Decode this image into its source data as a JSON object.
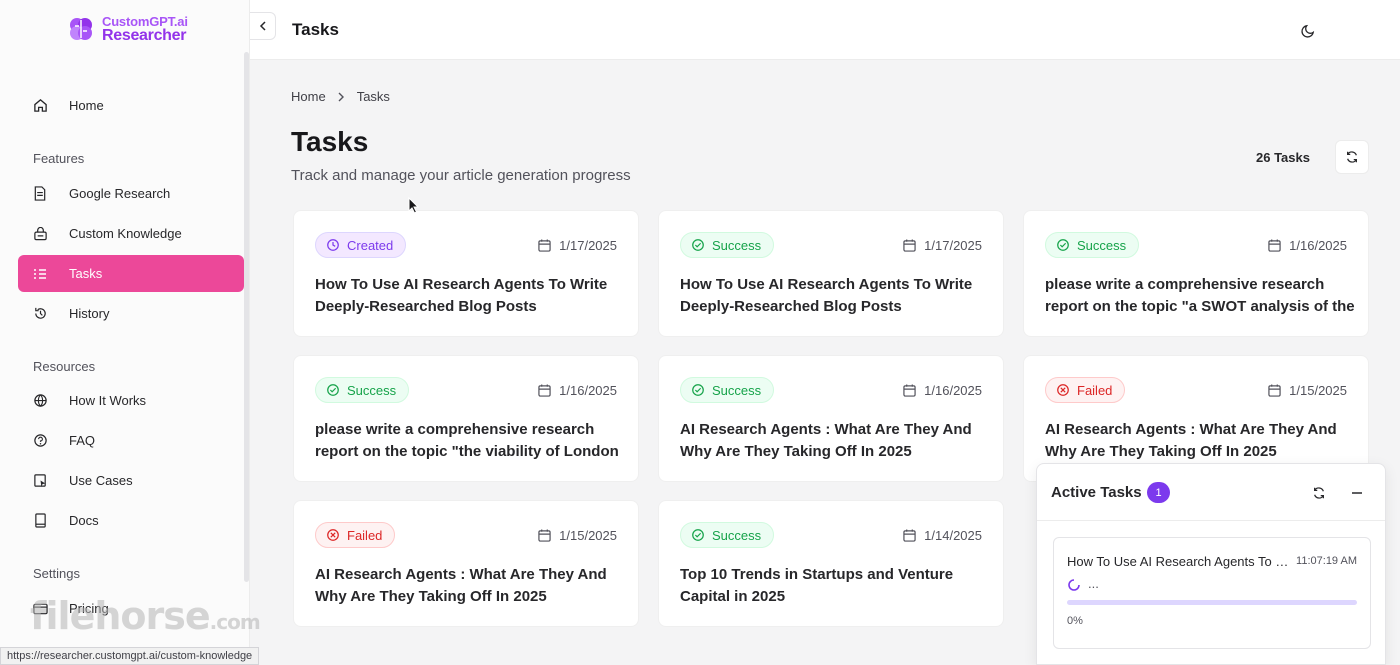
{
  "brand": {
    "line1": "CustomGPT.ai",
    "line2": "Researcher",
    "color": "#9333ea"
  },
  "sidebar": {
    "home": "Home",
    "sections": {
      "features": "Features",
      "resources": "Resources",
      "settings": "Settings"
    },
    "features": [
      {
        "label": "Google Research",
        "icon": "file-icon"
      },
      {
        "label": "Custom Knowledge",
        "icon": "knowledge-icon"
      },
      {
        "label": "Tasks",
        "icon": "list-icon",
        "active": true
      },
      {
        "label": "History",
        "icon": "history-icon"
      }
    ],
    "resources": [
      {
        "label": "How It Works",
        "icon": "globe-icon"
      },
      {
        "label": "FAQ",
        "icon": "help-icon"
      },
      {
        "label": "Use Cases",
        "icon": "use-cases-icon"
      },
      {
        "label": "Docs",
        "icon": "book-icon"
      }
    ],
    "settings": [
      {
        "label": "Pricing",
        "icon": "card-icon"
      }
    ],
    "accent": "#ec4899"
  },
  "topbar": {
    "title": "Tasks"
  },
  "breadcrumb": {
    "home": "Home",
    "current": "Tasks"
  },
  "page": {
    "title": "Tasks",
    "subtitle": "Track and manage your article generation progress",
    "task_count": "26 Tasks"
  },
  "tasks": [
    {
      "status": "Created",
      "date": "1/17/2025",
      "title": "How To Use AI Research Agents To Write Deeply-Researched Blog Posts"
    },
    {
      "status": "Success",
      "date": "1/17/2025",
      "title": "How To Use AI Research Agents To Write Deeply-Researched Blog Posts"
    },
    {
      "status": "Success",
      "date": "1/16/2025",
      "title": "please write a comprehensive research report on the topic \"a SWOT analysis of the"
    },
    {
      "status": "Success",
      "date": "1/16/2025",
      "title": "please write a comprehensive research report on the topic \"the viability of London"
    },
    {
      "status": "Success",
      "date": "1/16/2025",
      "title": "AI Research Agents : What Are They And Why Are They Taking Off In 2025"
    },
    {
      "status": "Failed",
      "date": "1/15/2025",
      "title": "AI Research Agents : What Are They And Why Are They Taking Off In 2025"
    },
    {
      "status": "Failed",
      "date": "1/15/2025",
      "title": "AI Research Agents : What Are They And Why Are They Taking Off In 2025"
    },
    {
      "status": "Success",
      "date": "1/14/2025",
      "title": "Top 10 Trends in Startups and Venture Capital in 2025"
    }
  ],
  "active_tasks": {
    "title": "Active Tasks",
    "count": "1",
    "item": {
      "title": "How To Use AI Research Agents To Write Deeply-Researched Blog Posts",
      "time": "11:07:19 AM",
      "status": "...",
      "progress": 0,
      "progress_label": "0%"
    }
  },
  "statusbar": {
    "url": "https://researcher.customgpt.ai/custom-knowledge"
  },
  "watermark": {
    "main": "filehorse",
    "suffix": ".com"
  }
}
